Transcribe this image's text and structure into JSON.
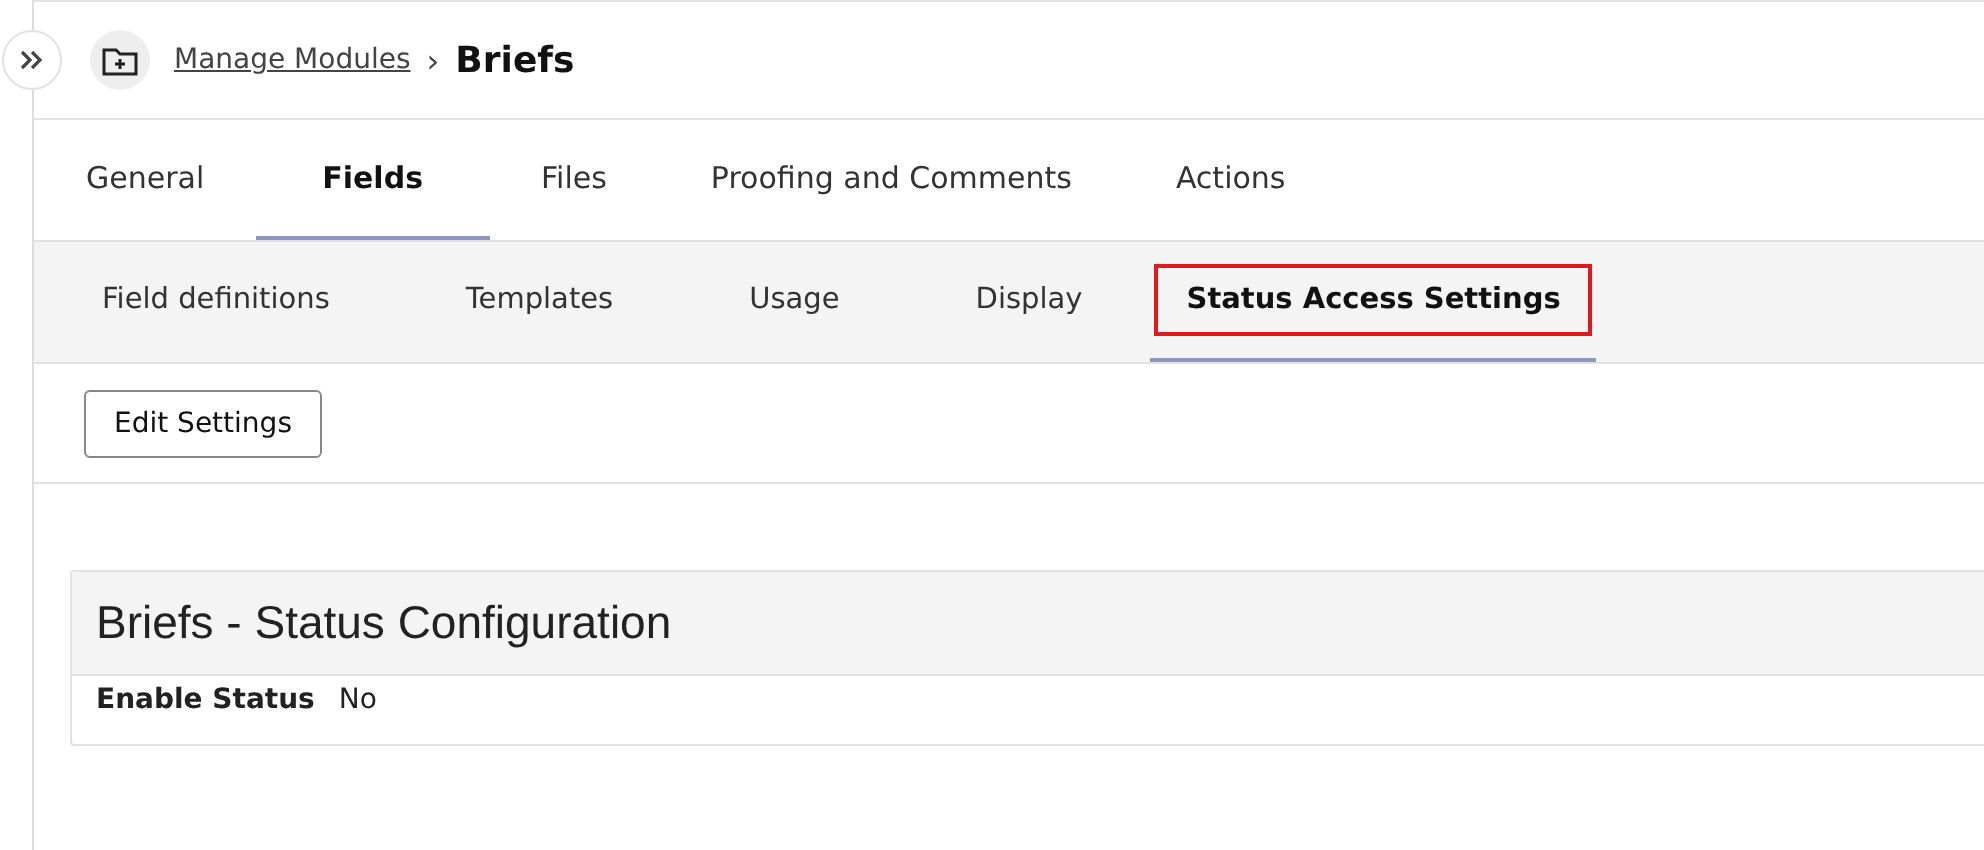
{
  "breadcrumb": {
    "parent": "Manage Modules",
    "separator": "›",
    "current": "Briefs"
  },
  "tabs": [
    {
      "label": "General",
      "selected": false
    },
    {
      "label": "Fields",
      "selected": true
    },
    {
      "label": "Files",
      "selected": false
    },
    {
      "label": "Proofing and Comments",
      "selected": false
    },
    {
      "label": "Actions",
      "selected": false
    }
  ],
  "subtabs": [
    {
      "label": "Field definitions",
      "selected": false,
      "highlighted": false
    },
    {
      "label": "Templates",
      "selected": false,
      "highlighted": false
    },
    {
      "label": "Usage",
      "selected": false,
      "highlighted": false
    },
    {
      "label": "Display",
      "selected": false,
      "highlighted": false
    },
    {
      "label": "Status Access Settings",
      "selected": true,
      "highlighted": true
    }
  ],
  "toolbar": {
    "button": "Edit Settings"
  },
  "panel": {
    "title": "Briefs - Status Configuration",
    "fields": [
      {
        "label": "Enable Status",
        "value": "No"
      }
    ]
  }
}
